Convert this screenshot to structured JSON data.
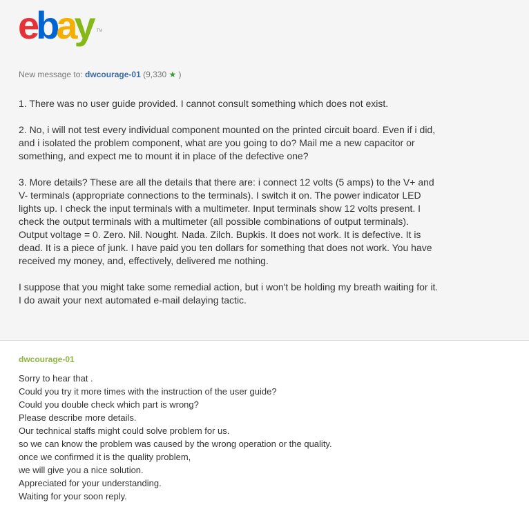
{
  "logo": {
    "e": "e",
    "b": "b",
    "a": "a",
    "y": "y",
    "tm": "TM"
  },
  "header": {
    "prefix": "New message to: ",
    "recipient": "dwcourage-01",
    "feedback_open": "(9,330 ",
    "feedback_close": " )",
    "star_icon": "star-icon"
  },
  "message": {
    "paragraphs": [
      "1. There was no user guide provided. I cannot consult something which does not exist.",
      "2. No, i will not test every individual component mounted on the printed circuit board. Even if i did, and i isolated the problem component, what are you going to do? Mail me a new capacitor or something, and expect me to mount it in place of the defective one?",
      "3. More details? These are all the details that there are: i connect 12 volts (5 amps) to the V+ and V- terminals (appropriate connections to the terminals). I switch it on. The power indicator LED lights up. I check the input terminals with a multimeter. Input terminals show 12 volts present. I check the output terminals with a multimeter (all possible combinations of output terminals). Output voltage = 0. Zero. Nil. Nought. Nada. Zilch. Bupkis. It does not work. It is defective. It is dead. It is a piece of junk. I have paid you ten dollars for something that does not work. You have received my money, and, effectively, delivered me nothing.",
      "I suppose that you might take some remedial action, but i won't be holding my breath waiting for it. I do await your next automated e-mail delaying tactic."
    ]
  },
  "reply": {
    "sender": "dwcourage-01",
    "lines": [
      "Sorry to hear that .",
      "Could you try it more times with the instruction of the user guide?",
      "Could you double check which part is wrong?",
      "Please describe more details.",
      "Our technical staffs might could solve problem for us.",
      "so we can know the problem was caused by the wrong operation or the quality.",
      "once we confirmed it is the quality problem,",
      "we will give you a nice solution.",
      "Appreciated for your understanding.",
      "Waiting for your soon reply."
    ]
  },
  "colors": {
    "e": "#e53238",
    "b": "#0064d2",
    "a": "#f5af02",
    "y": "#86b817",
    "link": "#3a6aa3",
    "reply_sender": "#8eb341",
    "star": "#3d9b35"
  }
}
